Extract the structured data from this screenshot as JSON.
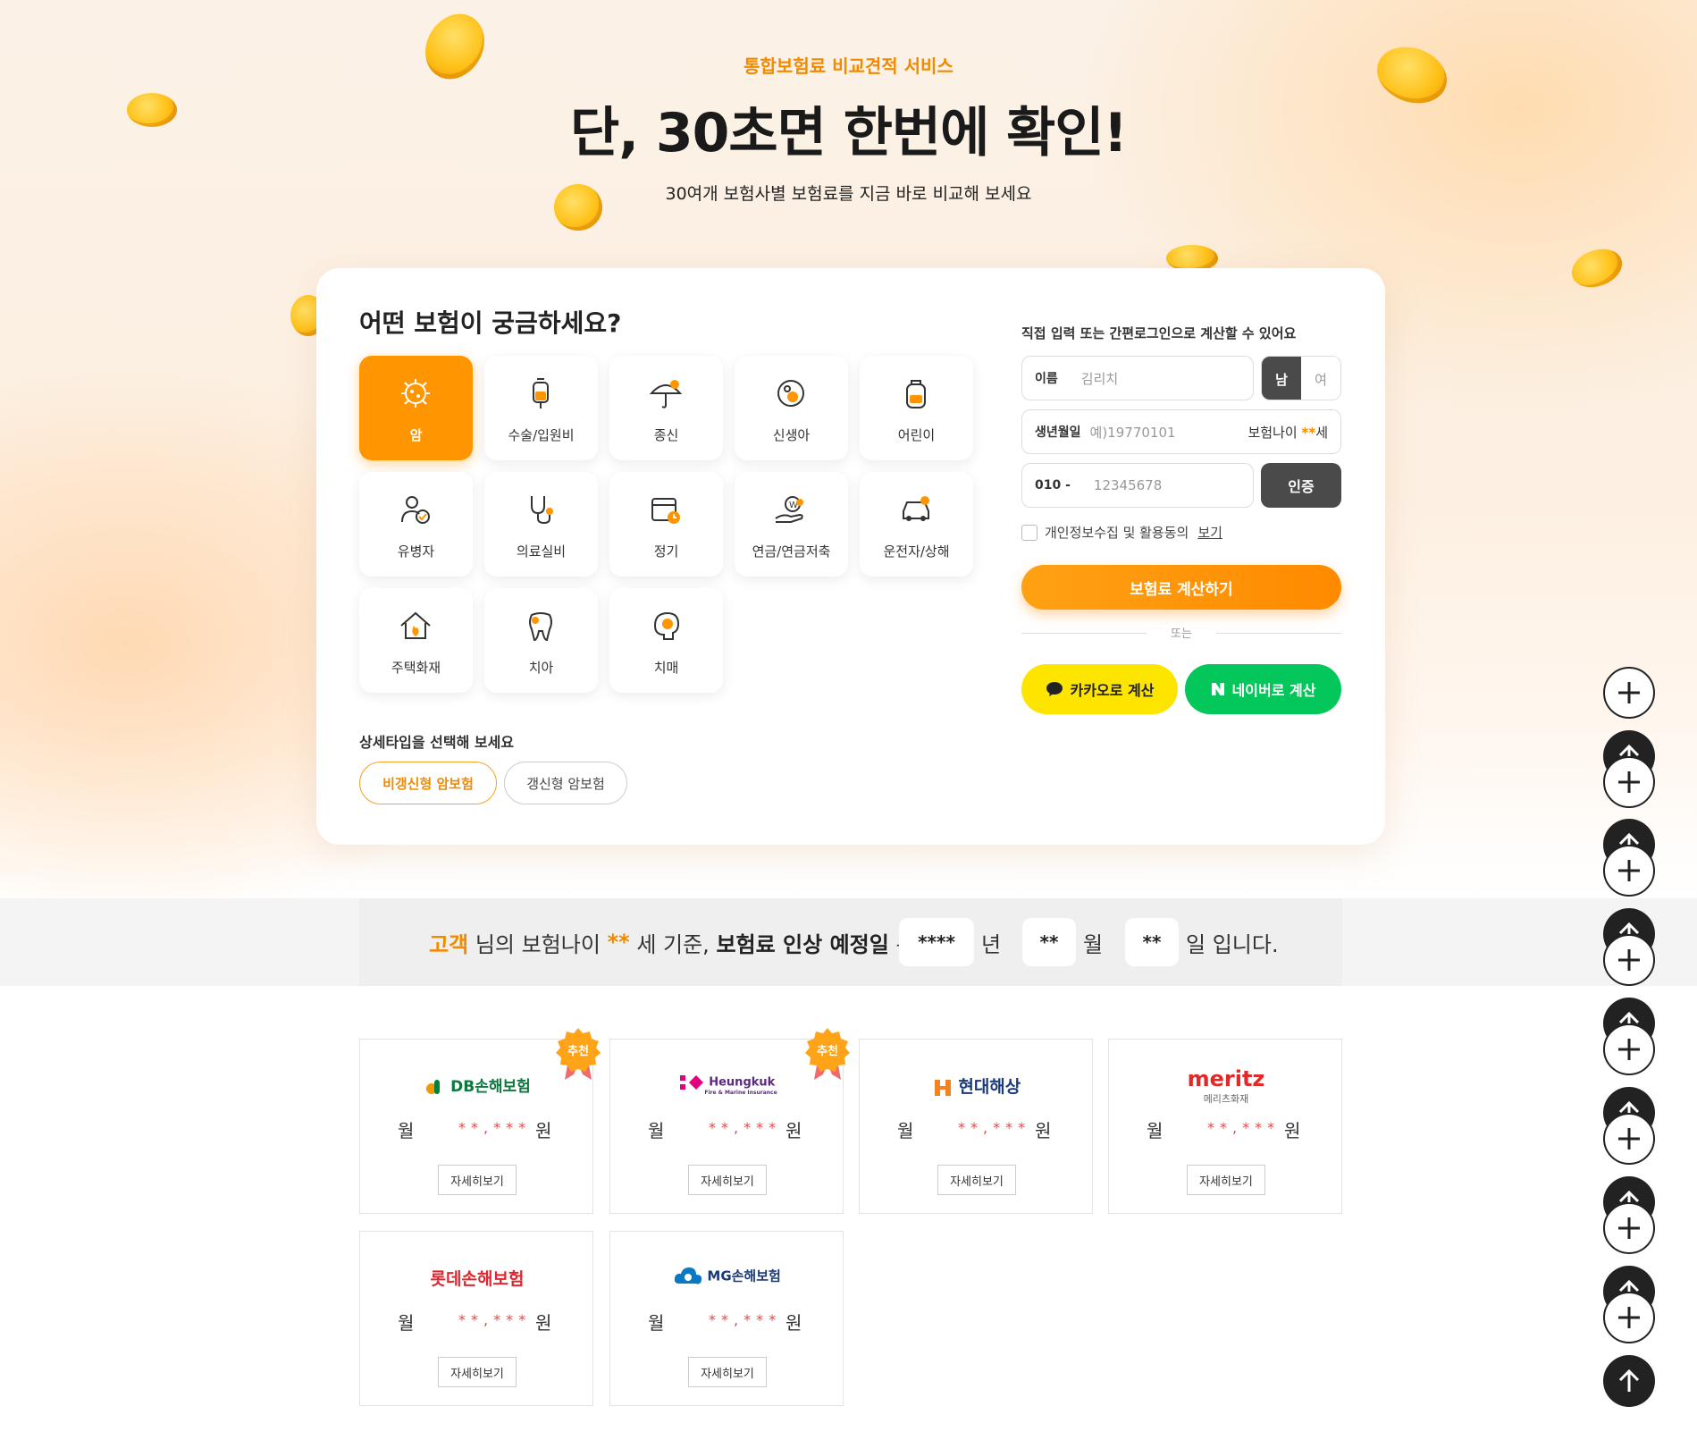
{
  "hero": {
    "eyebrow": "통합보험료 비교견적 서비스",
    "headline": "단, 30초면 한번에 확인!",
    "subline": "30여개 보험사별 보험료를 지금 바로 비교해 보세요"
  },
  "selector": {
    "title": "어떤 보험이 궁금하세요?",
    "categories": [
      {
        "label": "암",
        "icon": "virus-icon",
        "active": true
      },
      {
        "label": "수술/입원비",
        "icon": "iv-bag-icon"
      },
      {
        "label": "종신",
        "icon": "umbrella-icon"
      },
      {
        "label": "신생아",
        "icon": "baby-icon"
      },
      {
        "label": "어린이",
        "icon": "backpack-icon"
      },
      {
        "label": "유병자",
        "icon": "patient-icon"
      },
      {
        "label": "의료실비",
        "icon": "stethoscope-icon"
      },
      {
        "label": "정기",
        "icon": "calendar-clock-icon"
      },
      {
        "label": "연금/연금저축",
        "icon": "money-hand-icon"
      },
      {
        "label": "운전자/상해",
        "icon": "car-icon"
      },
      {
        "label": "주택화재",
        "icon": "house-fire-icon"
      },
      {
        "label": "치아",
        "icon": "tooth-icon"
      },
      {
        "label": "치매",
        "icon": "brain-icon"
      }
    ],
    "subtype_title": "상세타입을 선택해 보세요",
    "subtypes": [
      "비갱신형 암보험",
      "갱신형 암보험"
    ]
  },
  "form": {
    "title": "직접 입력 또는 간편로그인으로 계산할 수 있어요",
    "name_label": "이름",
    "name_placeholder": "김리치",
    "gender_male": "남",
    "gender_female": "여",
    "birth_label": "생년월일",
    "birth_placeholder": "예)19770101",
    "age_prefix": "보험나이",
    "age_mask": "**",
    "age_suffix": "세",
    "phone_prefix": "010 -",
    "phone_placeholder": "12345678",
    "verify_label": "인증",
    "consent_text": "개인정보수집 및 활용동의",
    "consent_link": "보기",
    "calc_label": "보험료 계산하기",
    "or_label": "또는",
    "kakao_label": "카카오로 계산",
    "naver_label": "네이버로 계산"
  },
  "notice": {
    "customer": "고객",
    "t1": "님의 보험나이",
    "age": "**",
    "t2": "세 기준,",
    "t3": "보험료 인상 예정일",
    "t4": "은",
    "year": "****",
    "year_unit": "년",
    "month": "**",
    "month_unit": "월",
    "day": "**",
    "day_unit": "일 입니다."
  },
  "insurers": [
    {
      "name": "DB손해보험",
      "badge": "추천",
      "month": "월",
      "price": "**,***",
      "unit": "원",
      "detail": "자세히보기"
    },
    {
      "name": "Heungkuk",
      "name_sub": "Fire & Marine Insurance",
      "badge": "추천",
      "month": "월",
      "price": "**,***",
      "unit": "원",
      "detail": "자세히보기"
    },
    {
      "name": "현대해상",
      "month": "월",
      "price": "**,***",
      "unit": "원",
      "detail": "자세히보기"
    },
    {
      "name": "meritz",
      "name_sub": "메리츠화재",
      "month": "월",
      "price": "**,***",
      "unit": "원",
      "detail": "자세히보기"
    },
    {
      "name": "롯데손해보험",
      "month": "월",
      "price": "**,***",
      "unit": "원",
      "detail": "자세히보기"
    },
    {
      "name": "MG손해보험",
      "month": "월",
      "price": "**,***",
      "unit": "원",
      "detail": "자세히보기"
    }
  ],
  "colors": {
    "accent": "#ff9500",
    "kakao": "#fee500",
    "naver": "#03c75a",
    "dark": "#4a4a4a"
  }
}
